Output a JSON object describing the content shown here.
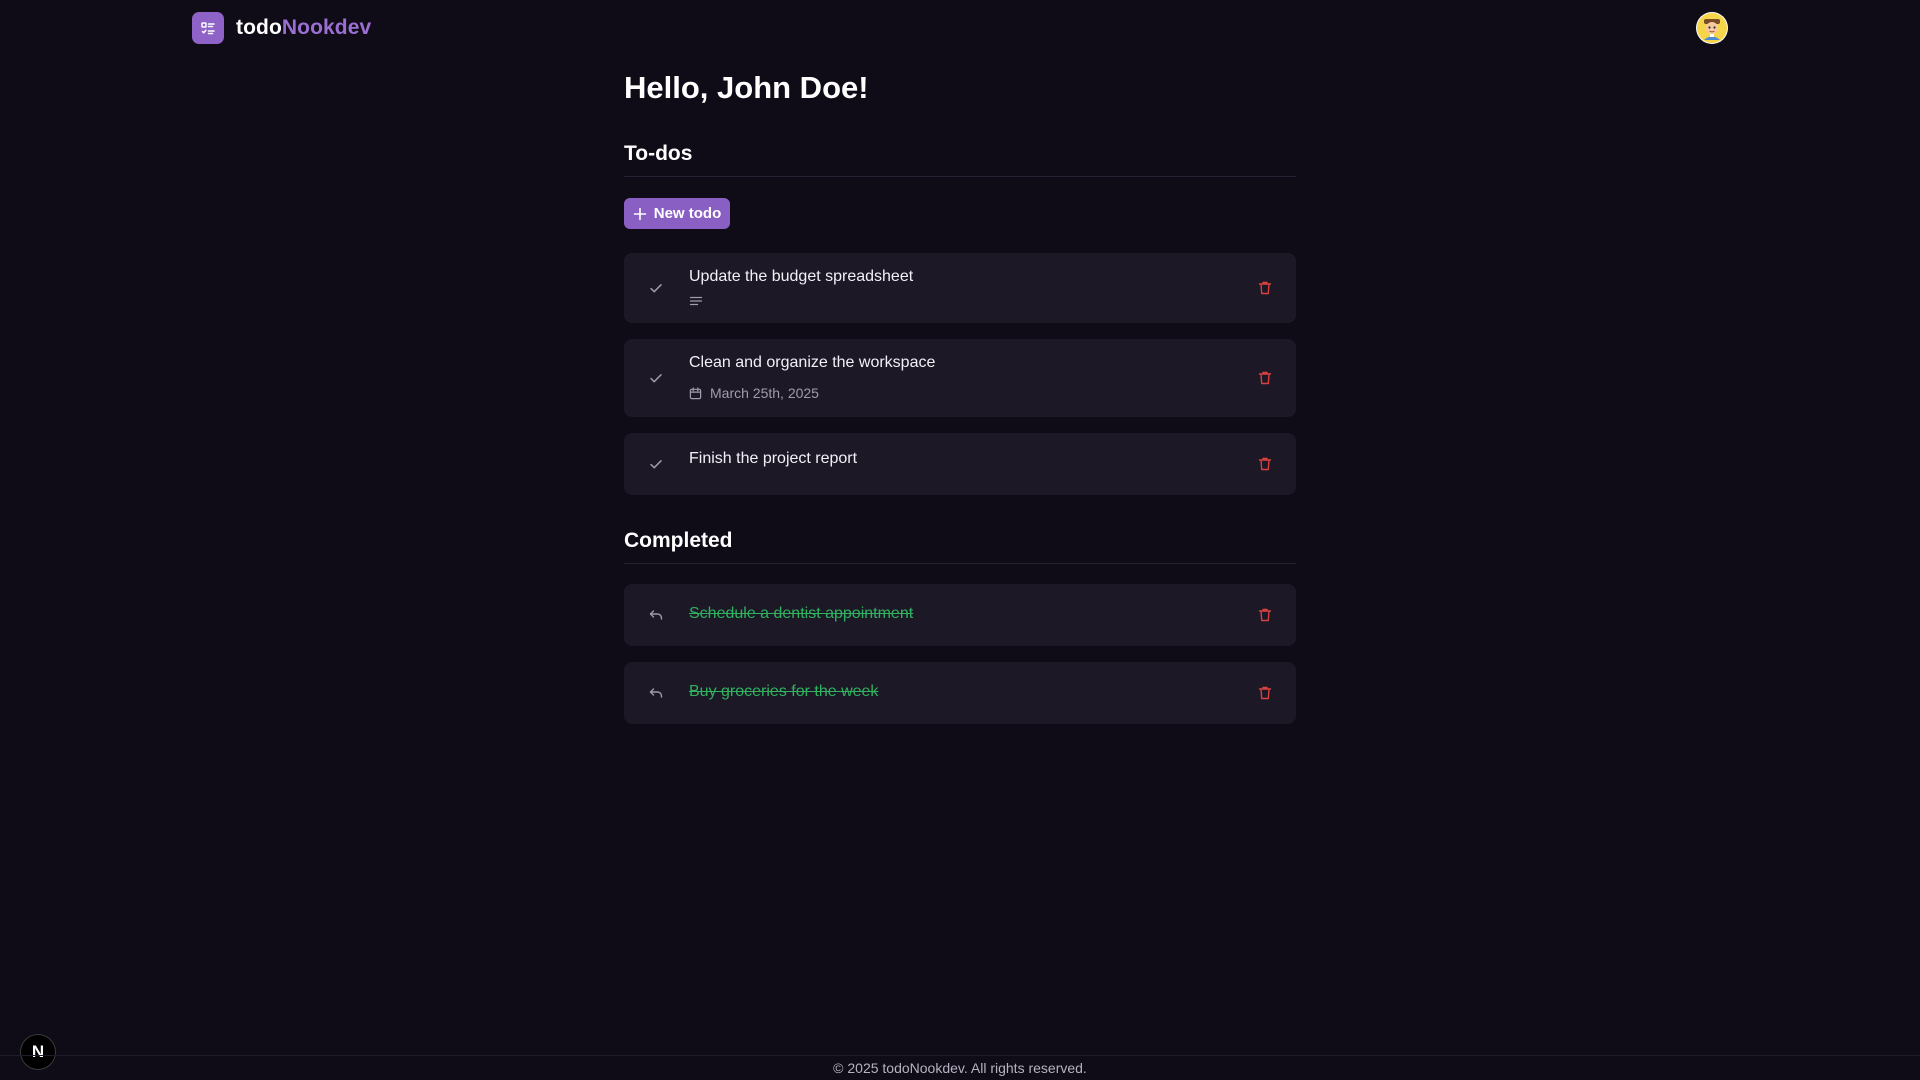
{
  "brand": {
    "name_primary": "todo",
    "name_accent": "Nookdev",
    "logo_icon": "list-checks-icon"
  },
  "header": {
    "avatar_icon": "user-avatar-icon"
  },
  "main": {
    "greeting": "Hello, John Doe!",
    "todos_title": "To-dos",
    "new_todo_label": "New todo",
    "completed_title": "Completed"
  },
  "todos": [
    {
      "title": "Update the budget spreadsheet",
      "meta_icon": "notes-icon",
      "meta_text": ""
    },
    {
      "title": "Clean and organize the workspace",
      "meta_icon": "calendar-icon",
      "meta_text": "March 25th, 2025"
    },
    {
      "title": "Finish the project report",
      "meta_icon": "",
      "meta_text": ""
    }
  ],
  "completed": [
    {
      "title": "Schedule a dentist appointment"
    },
    {
      "title": "Buy groceries for the week"
    }
  ],
  "footer": {
    "copyright": "© 2025 todoNookdev. All rights reserved.",
    "dev_badge": "N"
  },
  "colors": {
    "background": "#0f0b17",
    "card": "#1c1826",
    "accent": "#8a5fc4",
    "completed_text": "#2fb15f",
    "delete_icon": "#d94040"
  }
}
